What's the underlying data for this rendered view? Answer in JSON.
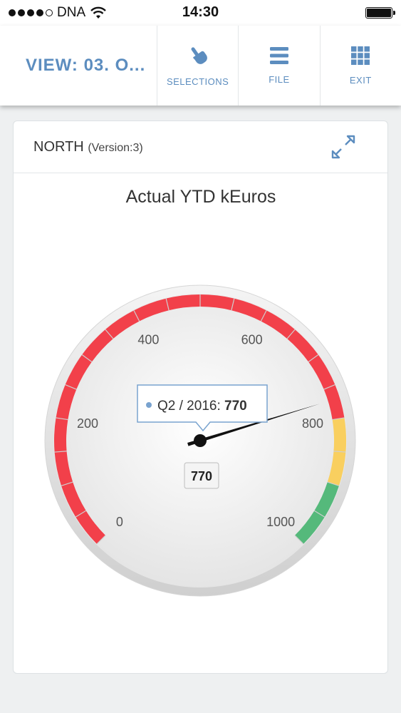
{
  "status_bar": {
    "carrier": "DNA",
    "time": "14:30"
  },
  "toolbar": {
    "view_title": "VIEW: 03. O...",
    "buttons": [
      {
        "label": "SELECTIONS",
        "icon": "hand-pointer-icon"
      },
      {
        "label": "FILE",
        "icon": "menu-icon"
      },
      {
        "label": "EXIT",
        "icon": "grid-icon"
      }
    ]
  },
  "card": {
    "title": "NORTH",
    "version": "(Version:3)"
  },
  "colors": {
    "accent": "#5c8dbf",
    "band_red": "#f2404a",
    "band_yellow": "#f9cf5f",
    "band_green": "#55b97b"
  },
  "chart_data": {
    "type": "gauge",
    "title": "Actual YTD kEuros",
    "min": 0,
    "max": 1000,
    "value": 770,
    "value_label": "770",
    "tick_labels": [
      "0",
      "200",
      "400",
      "600",
      "800",
      "1000"
    ],
    "tick_values": [
      0,
      200,
      400,
      600,
      800,
      1000
    ],
    "bands": [
      {
        "from": 0,
        "to": 800,
        "color": "#f2404a"
      },
      {
        "from": 800,
        "to": 900,
        "color": "#f9cf5f"
      },
      {
        "from": 900,
        "to": 1000,
        "color": "#55b97b"
      }
    ],
    "tooltip": {
      "series": "Q2 / 2016",
      "value": "770"
    }
  }
}
